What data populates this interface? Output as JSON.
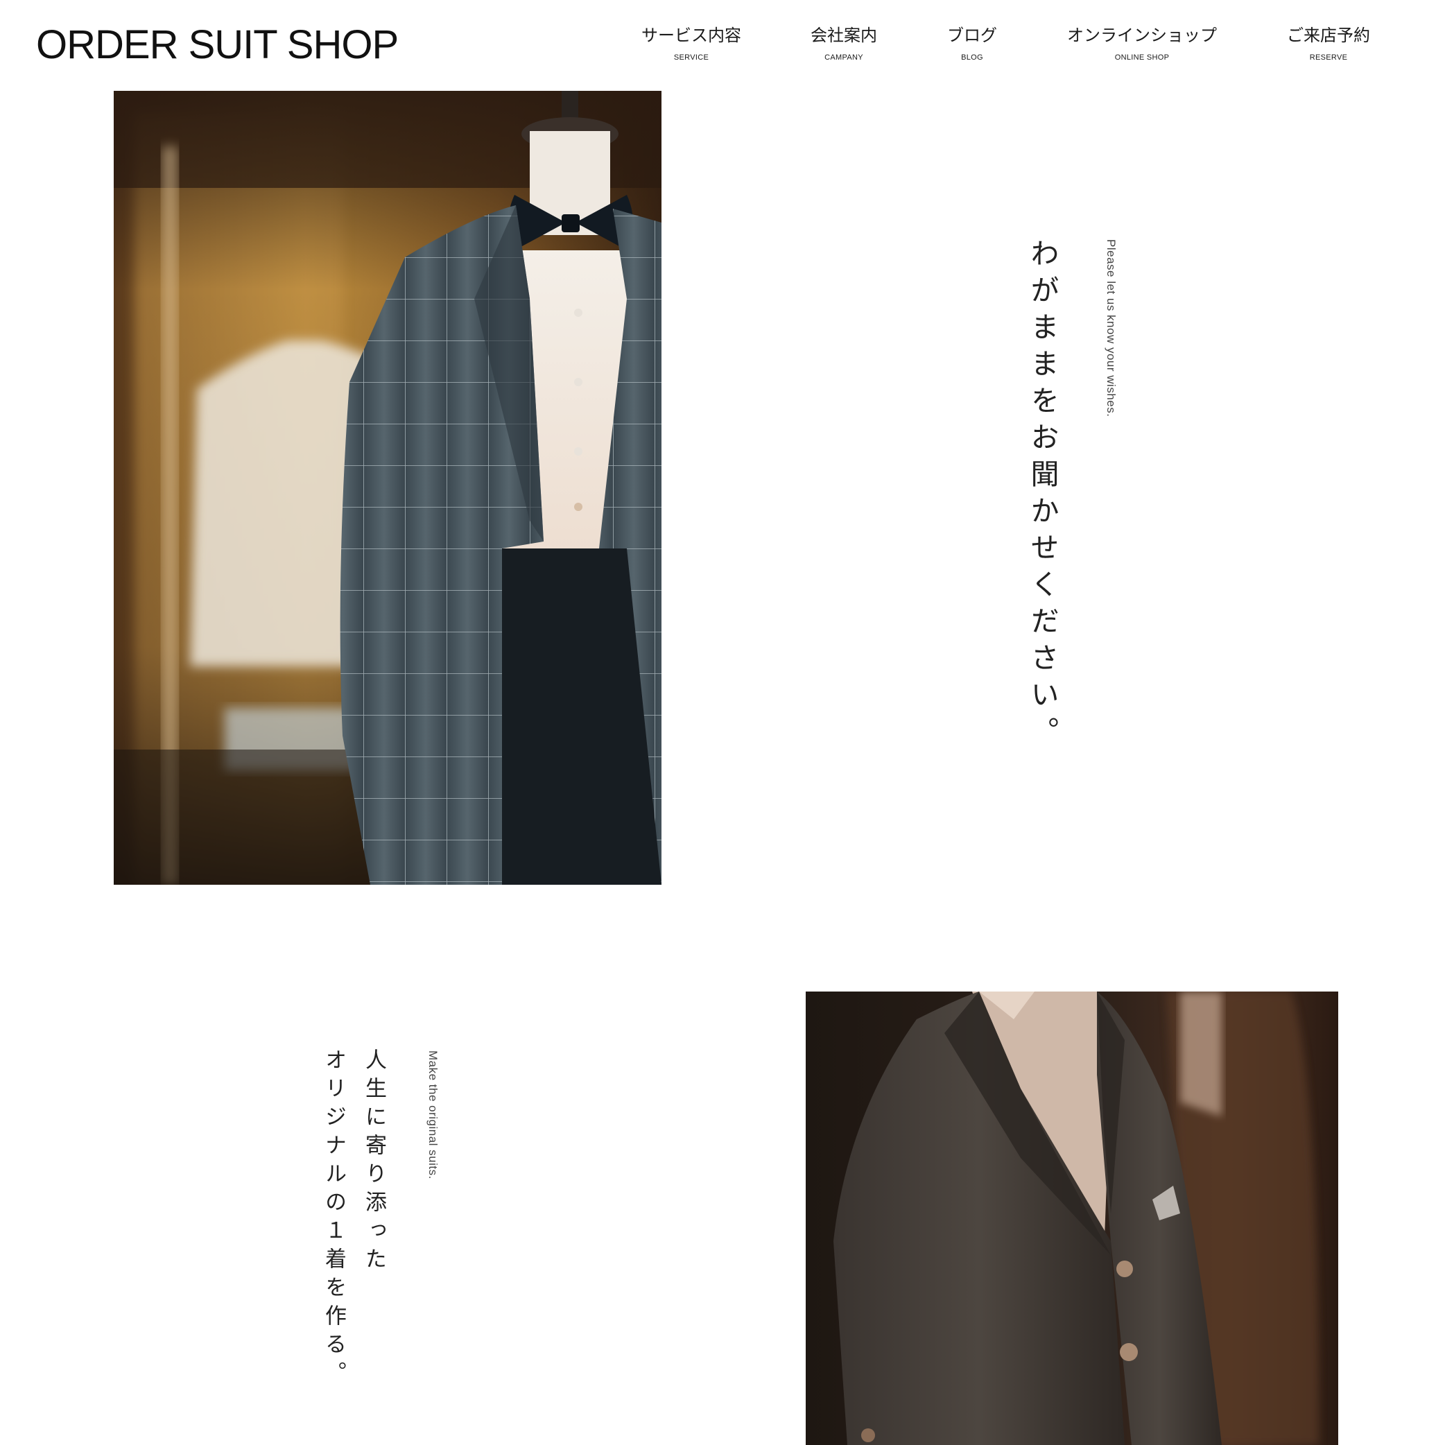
{
  "site": {
    "logo": "ORDER SUIT SHOP"
  },
  "nav": {
    "items": [
      {
        "jp": "サービス内容",
        "en": "SERVICE"
      },
      {
        "jp": "会社案内",
        "en": "CAMPANY"
      },
      {
        "jp": "ブログ",
        "en": "BLOG"
      },
      {
        "jp": "オンラインショップ",
        "en": "ONLINE SHOP"
      },
      {
        "jp": "ご来店予約",
        "en": "RESERVE"
      }
    ]
  },
  "sections": [
    {
      "heading": "わがままをお聞かせください。",
      "subheading": "Please let us know your wishes.",
      "image": "suit-on-mannequin-with-bow-tie-photo"
    },
    {
      "heading_lines": [
        "人生に寄り添った",
        "オリジナルの１着を作る。"
      ],
      "subheading": "Make the original suits.",
      "image": "dark-jacket-on-mannequin-photo"
    }
  ],
  "colors": {
    "background": "#ffffff",
    "text": "#1a1a1a",
    "photo_warm": "#b07a2a",
    "photo_dark": "#2a1c14"
  }
}
